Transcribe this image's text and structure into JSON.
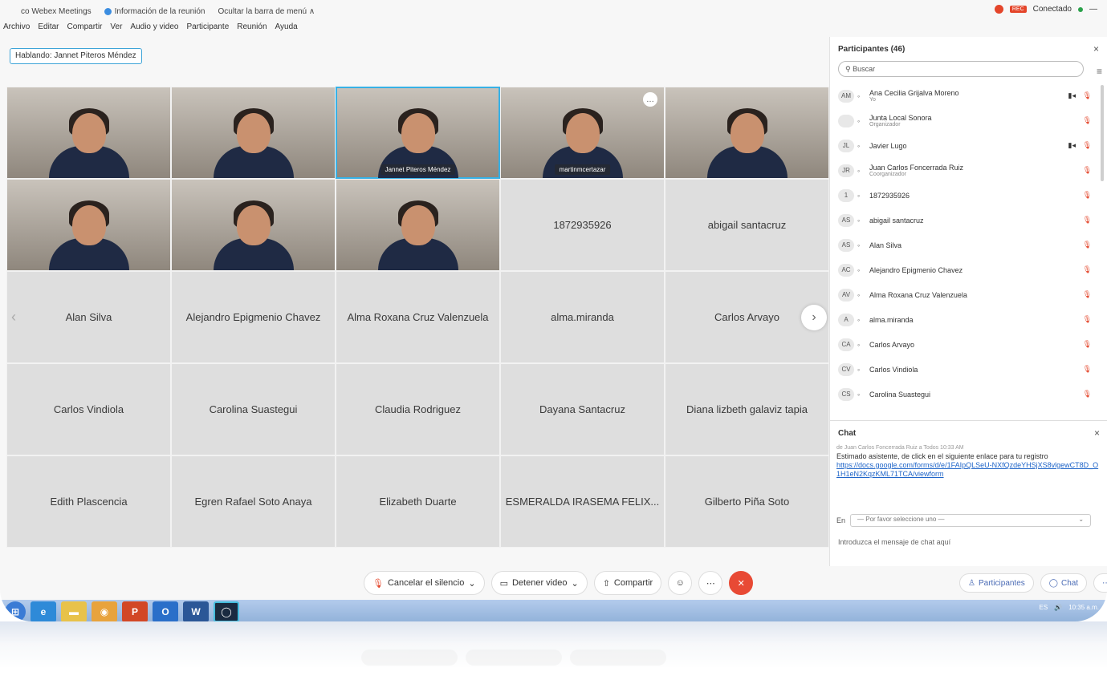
{
  "titlebar": {
    "app": "co Webex Meetings",
    "info": "Información de la reunión",
    "hide": "Ocultar la barra de menú ∧",
    "status": "Conectado",
    "rec": "REC"
  },
  "menu": [
    "Archivo",
    "Editar",
    "Compartir",
    "Ver",
    "Audio y video",
    "Participante",
    "Reunión",
    "Ayuda"
  ],
  "speaking": "Hablando: Jannet Piteros Méndez",
  "tiles": [
    {
      "name": "",
      "video": true
    },
    {
      "name": "",
      "video": true
    },
    {
      "name": "Jannet Piteros Méndez",
      "video": true,
      "active": true
    },
    {
      "name": "martinmcertazar",
      "video": true,
      "more": "…"
    },
    {
      "name": "",
      "video": true
    },
    {
      "name": "",
      "video": true
    },
    {
      "name": "",
      "video": true
    },
    {
      "name": "",
      "video": true
    },
    {
      "name": "1872935926",
      "video": false
    },
    {
      "name": "abigail santacruz",
      "video": false
    },
    {
      "name": "Alan Silva",
      "video": false
    },
    {
      "name": "Alejandro Epigmenio Chavez",
      "video": false
    },
    {
      "name": "Alma Roxana Cruz Valenzuela",
      "video": false
    },
    {
      "name": "alma.miranda",
      "video": false
    },
    {
      "name": "Carlos Arvayo",
      "video": false
    },
    {
      "name": "Carlos Vindiola",
      "video": false
    },
    {
      "name": "Carolina Suastegui",
      "video": false
    },
    {
      "name": "Claudia Rodriguez",
      "video": false
    },
    {
      "name": "Dayana Santacruz",
      "video": false
    },
    {
      "name": "Diana lizbeth galaviz tapia",
      "video": false
    },
    {
      "name": "Edith Plascencia",
      "video": false
    },
    {
      "name": "Egren Rafael Soto Anaya",
      "video": false
    },
    {
      "name": "Elizabeth Duarte",
      "video": false
    },
    {
      "name": "ESMERALDA IRASEMA FELIX...",
      "video": false
    },
    {
      "name": "Gilberto Piña Soto",
      "video": false
    }
  ],
  "controls": {
    "mute": "Cancelar el silencio",
    "video": "Detener video",
    "share": "Compartir"
  },
  "participants_panel": {
    "title": "Participantes (46)",
    "search_placeholder": "Buscar",
    "list": [
      {
        "initials": "AM",
        "name": "Ana Cecilia Grijalva Moreno",
        "sub": "Yo",
        "cam": true
      },
      {
        "initials": "",
        "name": "Junta Local Sonora",
        "sub": "Organizador",
        "cam": false
      },
      {
        "initials": "JL",
        "name": "Javier Lugo",
        "sub": "",
        "cam": true
      },
      {
        "initials": "JR",
        "name": "Juan Carlos Foncerrada Ruiz",
        "sub": "Coorganizador",
        "cam": false
      },
      {
        "initials": "1",
        "name": "1872935926",
        "sub": "",
        "cam": false
      },
      {
        "initials": "AS",
        "name": "abigail santacruz",
        "sub": "",
        "cam": false
      },
      {
        "initials": "AS",
        "name": "Alan Silva",
        "sub": "",
        "cam": false
      },
      {
        "initials": "AC",
        "name": "Alejandro Epigmenio Chavez",
        "sub": "",
        "cam": false
      },
      {
        "initials": "AV",
        "name": "Alma Roxana Cruz Valenzuela",
        "sub": "",
        "cam": false
      },
      {
        "initials": "A",
        "name": "alma.miranda",
        "sub": "",
        "cam": false
      },
      {
        "initials": "CA",
        "name": "Carlos Arvayo",
        "sub": "",
        "cam": false
      },
      {
        "initials": "CV",
        "name": "Carlos Vindiola",
        "sub": "",
        "cam": false
      },
      {
        "initials": "CS",
        "name": "Carolina Suastegui",
        "sub": "",
        "cam": false
      }
    ]
  },
  "chat": {
    "title": "Chat",
    "meta": "de Juan Carlos Foncerrada Ruiz a Todos   10:33 AM",
    "message": "Estimado asistente, de click en el siguiente enlace para tu registro",
    "link": "https://docs.google.com/forms/d/e/1FAIpQLSeU-NXfQzdeYHSjXS8vlgewCT8D_O1H1eN2KqzKML71TCA/viewform",
    "to_label": "En",
    "select_placeholder": "— Por favor seleccione uno —",
    "input_placeholder": "Introduzca el mensaje de chat aquí"
  },
  "footer": {
    "participants": "Participantes",
    "chat": "Chat"
  },
  "taskbar": {
    "lang": "ES",
    "time": "10:35 a.m."
  },
  "colors": {
    "accent": "#37b1e6",
    "end_call": "#e84a35",
    "link": "#1e64c8"
  }
}
